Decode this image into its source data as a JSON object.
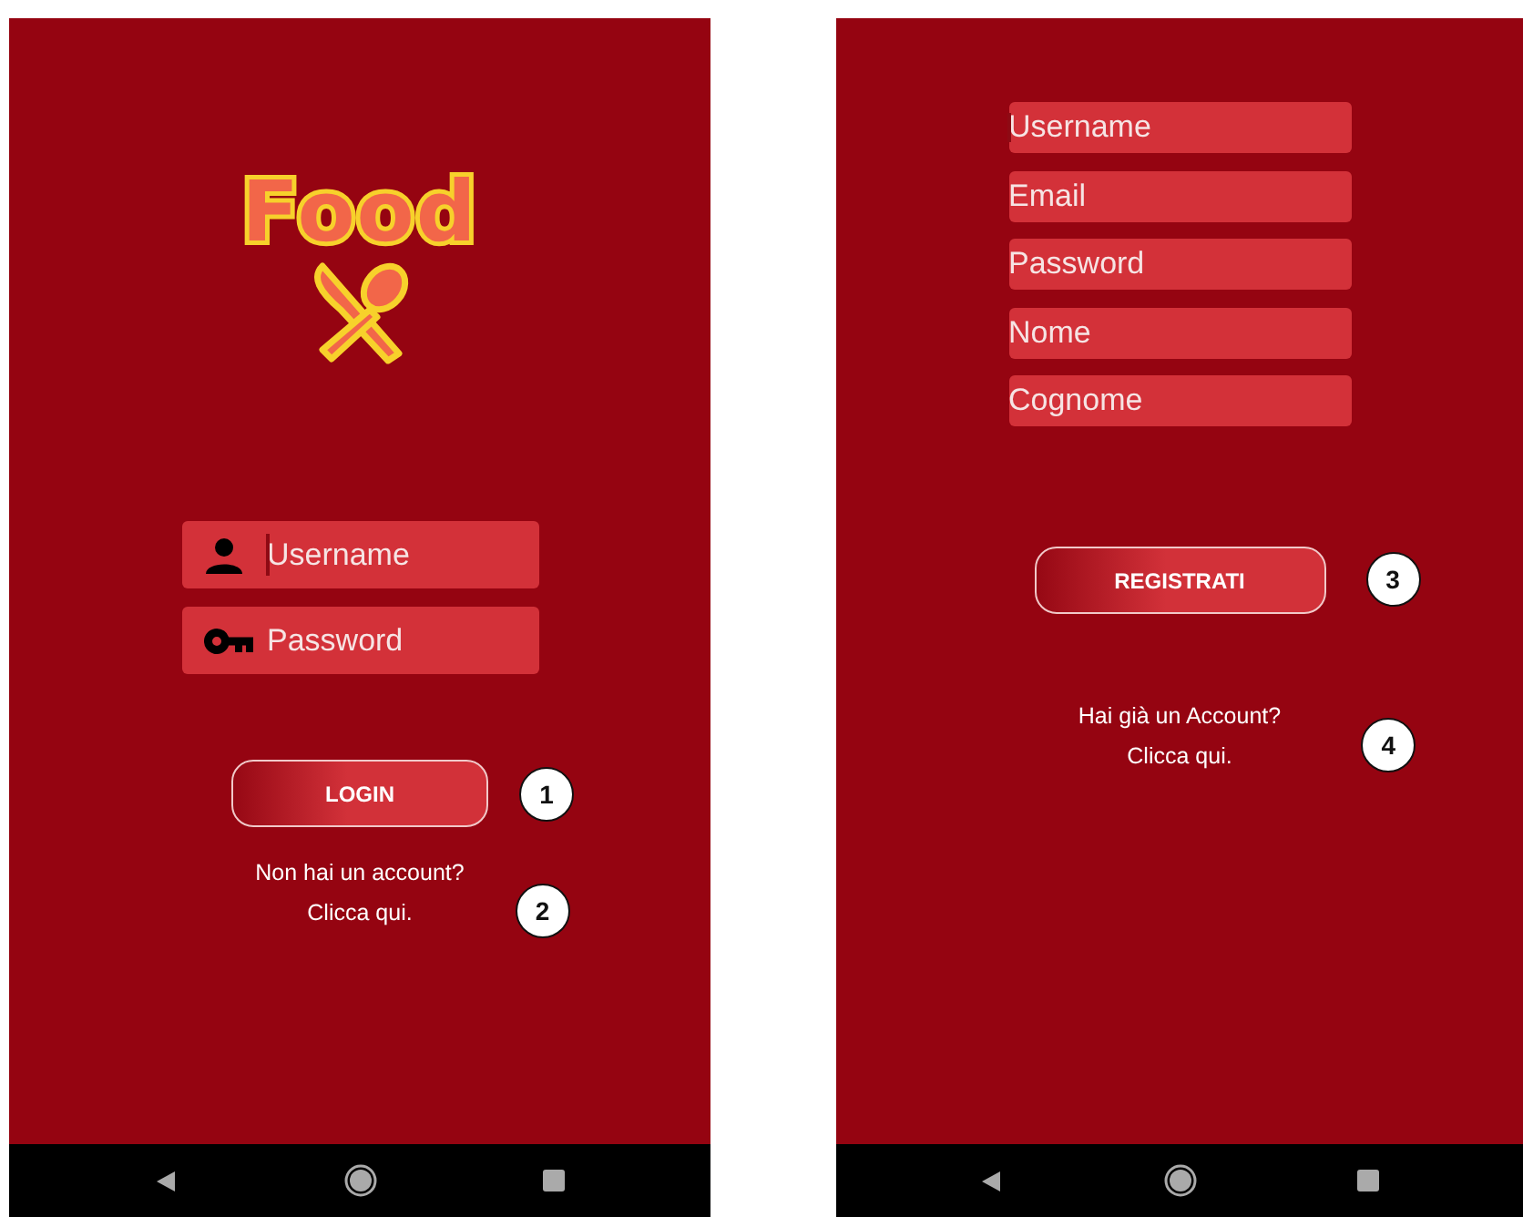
{
  "screens": [
    {
      "kind": "login",
      "logo_text": "Food",
      "fields": [
        {
          "placeholder": "Username",
          "focused": true
        },
        {
          "placeholder": "Password",
          "focused": false
        }
      ],
      "button": {
        "label": "LOGIN",
        "badge": "1"
      },
      "link": {
        "lines": [
          "Non hai un account?",
          "Clicca qui."
        ],
        "badge": "2"
      }
    },
    {
      "kind": "register",
      "fields": [
        {
          "placeholder": "Username",
          "focused": true
        },
        {
          "placeholder": "Email",
          "focused": false
        },
        {
          "placeholder": "Password",
          "focused": false
        },
        {
          "placeholder": "Nome",
          "focused": false
        },
        {
          "placeholder": "Cognome",
          "focused": false
        }
      ],
      "button": {
        "label": "REGISTRATI",
        "badge": "3"
      },
      "link": {
        "lines": [
          "Hai già un Account?",
          "Clicca qui."
        ],
        "badge": "4"
      }
    }
  ]
}
